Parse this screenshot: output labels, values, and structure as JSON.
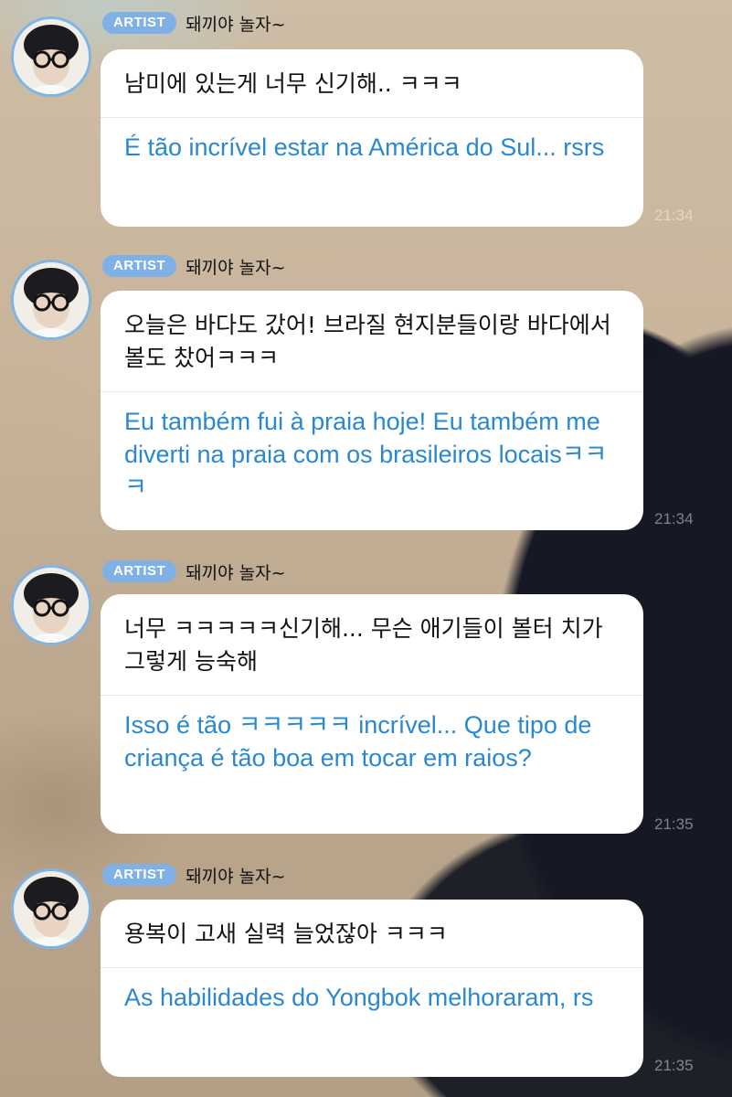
{
  "messages": [
    {
      "badge": "ARTIST",
      "nickname": "돼끼야 놀자~",
      "original": "남미에 있는게 너무 신기해.. ㅋㅋㅋ",
      "translation": "É tão incrível estar na América do Sul... rsrs",
      "time": "21:34"
    },
    {
      "badge": "ARTIST",
      "nickname": "돼끼야 놀자~",
      "original": "오늘은 바다도 갔어! 브라질 현지분들이랑 바다에서 볼도 찼어ㅋㅋㅋ",
      "translation": "Eu também fui à praia hoje! Eu também me diverti na praia com os brasileiros locaisㅋㅋㅋ",
      "time": "21:34"
    },
    {
      "badge": "ARTIST",
      "nickname": "돼끼야 놀자~",
      "original": "너무 ㅋㅋㅋㅋㅋ신기해... 무슨 애기들이 볼터 치가 그렇게 능숙해",
      "translation": "Isso é tão ㅋㅋㅋㅋㅋ incrível... Que tipo de criança é tão boa em tocar em raios?",
      "time": "21:35"
    },
    {
      "badge": "ARTIST",
      "nickname": "돼끼야 놀자~",
      "original": "용복이 고새 실력 늘었잖아 ㅋㅋㅋ",
      "translation": "As habilidades do Yongbok melhoraram, rs",
      "time": "21:35"
    }
  ],
  "colors": {
    "badge": "#7fb0e6",
    "translation_text": "#2a88cf",
    "bubble": "#ffffff",
    "avatar_ring": "#7fb4e8"
  }
}
